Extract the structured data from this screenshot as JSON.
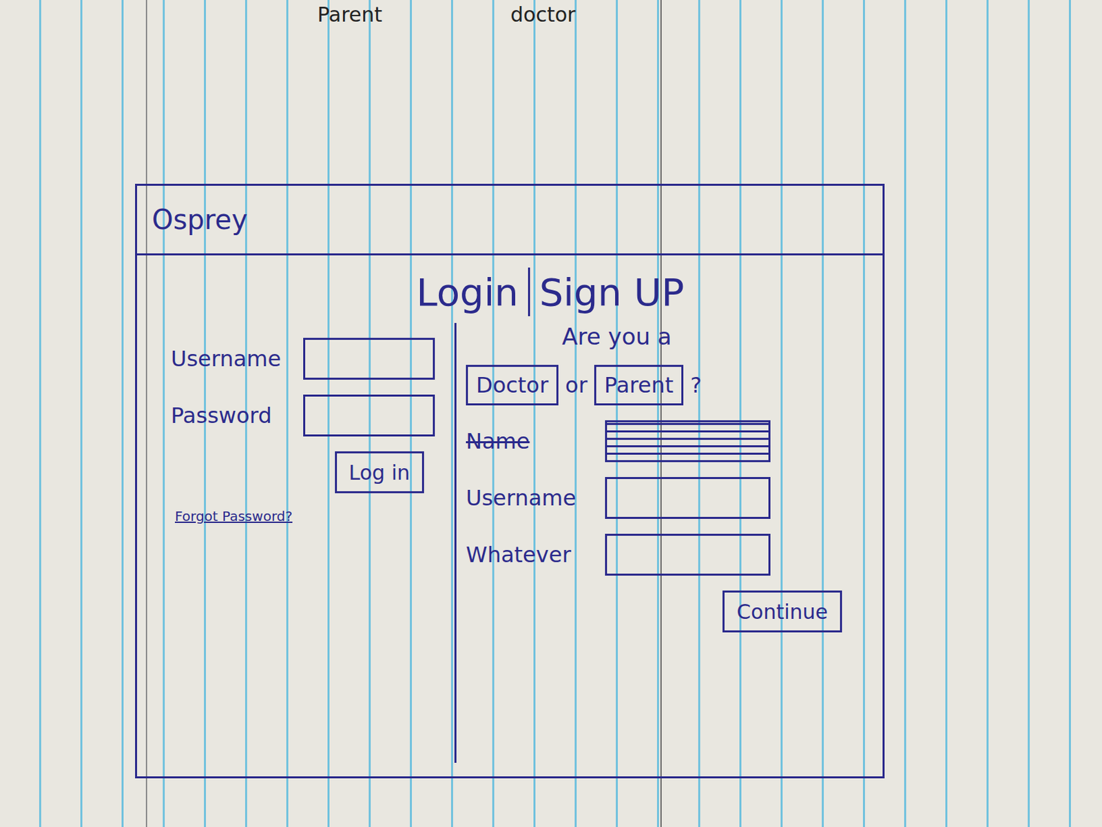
{
  "page_notes": [
    "Parent",
    "doctor"
  ],
  "app": {
    "logo": "Osprey"
  },
  "title": {
    "login": "Login",
    "signup": "Sign UP"
  },
  "login": {
    "fields": [
      {
        "label": "Username"
      },
      {
        "label": "Password"
      }
    ],
    "button": "Log in",
    "forgot": "Forgot Password?"
  },
  "signup": {
    "question": "Are you a",
    "roles": [
      {
        "label": "Doctor",
        "selected": false
      },
      {
        "label": "Parent",
        "selected": false
      }
    ],
    "or": "or",
    "question_end": "?",
    "fields": [
      {
        "label": "Name",
        "crossed_out": true
      },
      {
        "label": "Username",
        "crossed_out": false
      },
      {
        "label": "Whatever",
        "crossed_out": false
      }
    ],
    "button": "Continue"
  }
}
